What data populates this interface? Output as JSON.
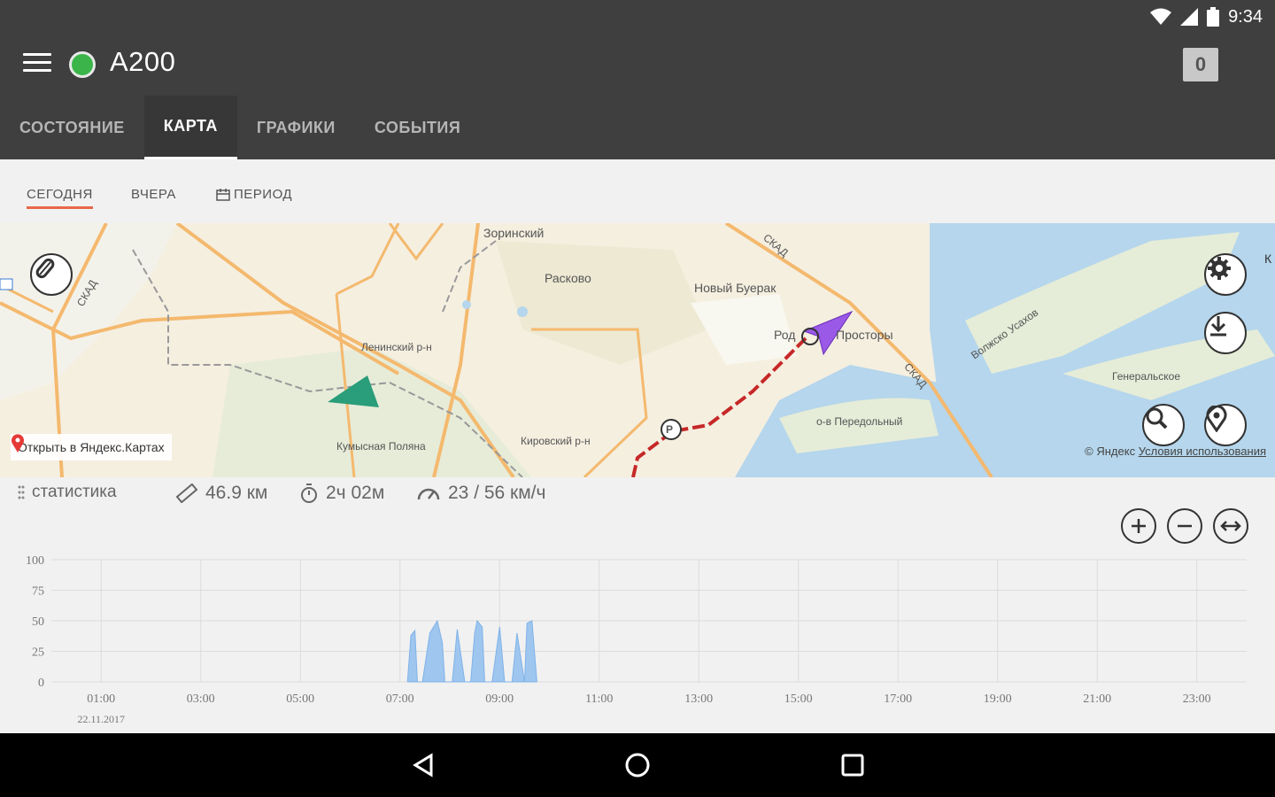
{
  "status_bar": {
    "time": "9:34",
    "icons": [
      "wifi-icon",
      "cellular-icon",
      "battery-icon"
    ]
  },
  "app": {
    "title": "A200",
    "status_color": "#3bb54a",
    "notification_count": "0"
  },
  "tabs": [
    {
      "label": "СОСТОЯНИЕ",
      "active": false
    },
    {
      "label": "КАРТА",
      "active": true
    },
    {
      "label": "ГРАФИКИ",
      "active": false
    },
    {
      "label": "СОБЫТИЯ",
      "active": false
    }
  ],
  "period_tabs": [
    {
      "label": "СЕГОДНЯ",
      "active": true
    },
    {
      "label": "ВЧЕРА",
      "active": false
    },
    {
      "label": "ПЕРИОД",
      "active": false,
      "icon": "calendar-icon"
    }
  ],
  "map": {
    "labels": {
      "zorinsky": "Зоринский",
      "raskovo": "Расково",
      "novy_buerak": "Новый Буерак",
      "rod": "Род",
      "prostory": "Просторы",
      "leninsky": "Ленинский р-н",
      "kumysnaya": "Кумысная Поляна",
      "kirovsky": "Кировский р-н",
      "generalskoe": "Генеральское",
      "volga_arm": "Волжско Усахов",
      "peredolny": "о-в Передольный",
      "skad1": "СКАД",
      "skad2": "СКАД",
      "skad3": "СКАД",
      "k_edge": "К"
    },
    "parking_marker": "P",
    "open_in_yandex": "Открыть в Яндекс.Картах",
    "copyright": "© Яндекс",
    "terms": "Условия использования",
    "colors": {
      "start_marker": "#2a9d7a",
      "current_marker": "#9b59e8",
      "track": "#c62828",
      "water": "#b5d6ec"
    }
  },
  "stats": {
    "label": "статистика",
    "distance": "46.9 км",
    "duration": "2ч 02м",
    "speed": "23 / 56 км/ч"
  },
  "chart_data": {
    "type": "area",
    "title": "",
    "xlabel": "",
    "ylabel": "",
    "ylim": [
      0,
      100
    ],
    "yticks": [
      "100",
      "75",
      "50",
      "25",
      "0"
    ],
    "xticks": [
      "01:00",
      "03:00",
      "05:00",
      "07:00",
      "09:00",
      "11:00",
      "13:00",
      "15:00",
      "17:00",
      "19:00",
      "21:00",
      "23:00"
    ],
    "date_label": "22.11.2017",
    "xlim_hours": [
      0,
      24
    ],
    "color": "#9ec6ef",
    "series": [
      {
        "x": [
          7.15,
          7.22,
          7.3,
          7.35,
          7.45,
          7.6,
          7.75,
          7.85,
          7.9,
          8.05,
          8.15,
          8.3,
          8.42,
          8.5,
          8.55,
          8.65,
          8.7,
          8.85,
          9.0,
          9.1,
          9.25,
          9.35,
          9.5,
          9.55,
          9.65,
          9.75
        ],
        "y": [
          0,
          38,
          42,
          0,
          0,
          40,
          50,
          32,
          0,
          0,
          43,
          0,
          0,
          40,
          50,
          45,
          0,
          0,
          45,
          0,
          0,
          40,
          0,
          48,
          50,
          0
        ]
      }
    ]
  }
}
